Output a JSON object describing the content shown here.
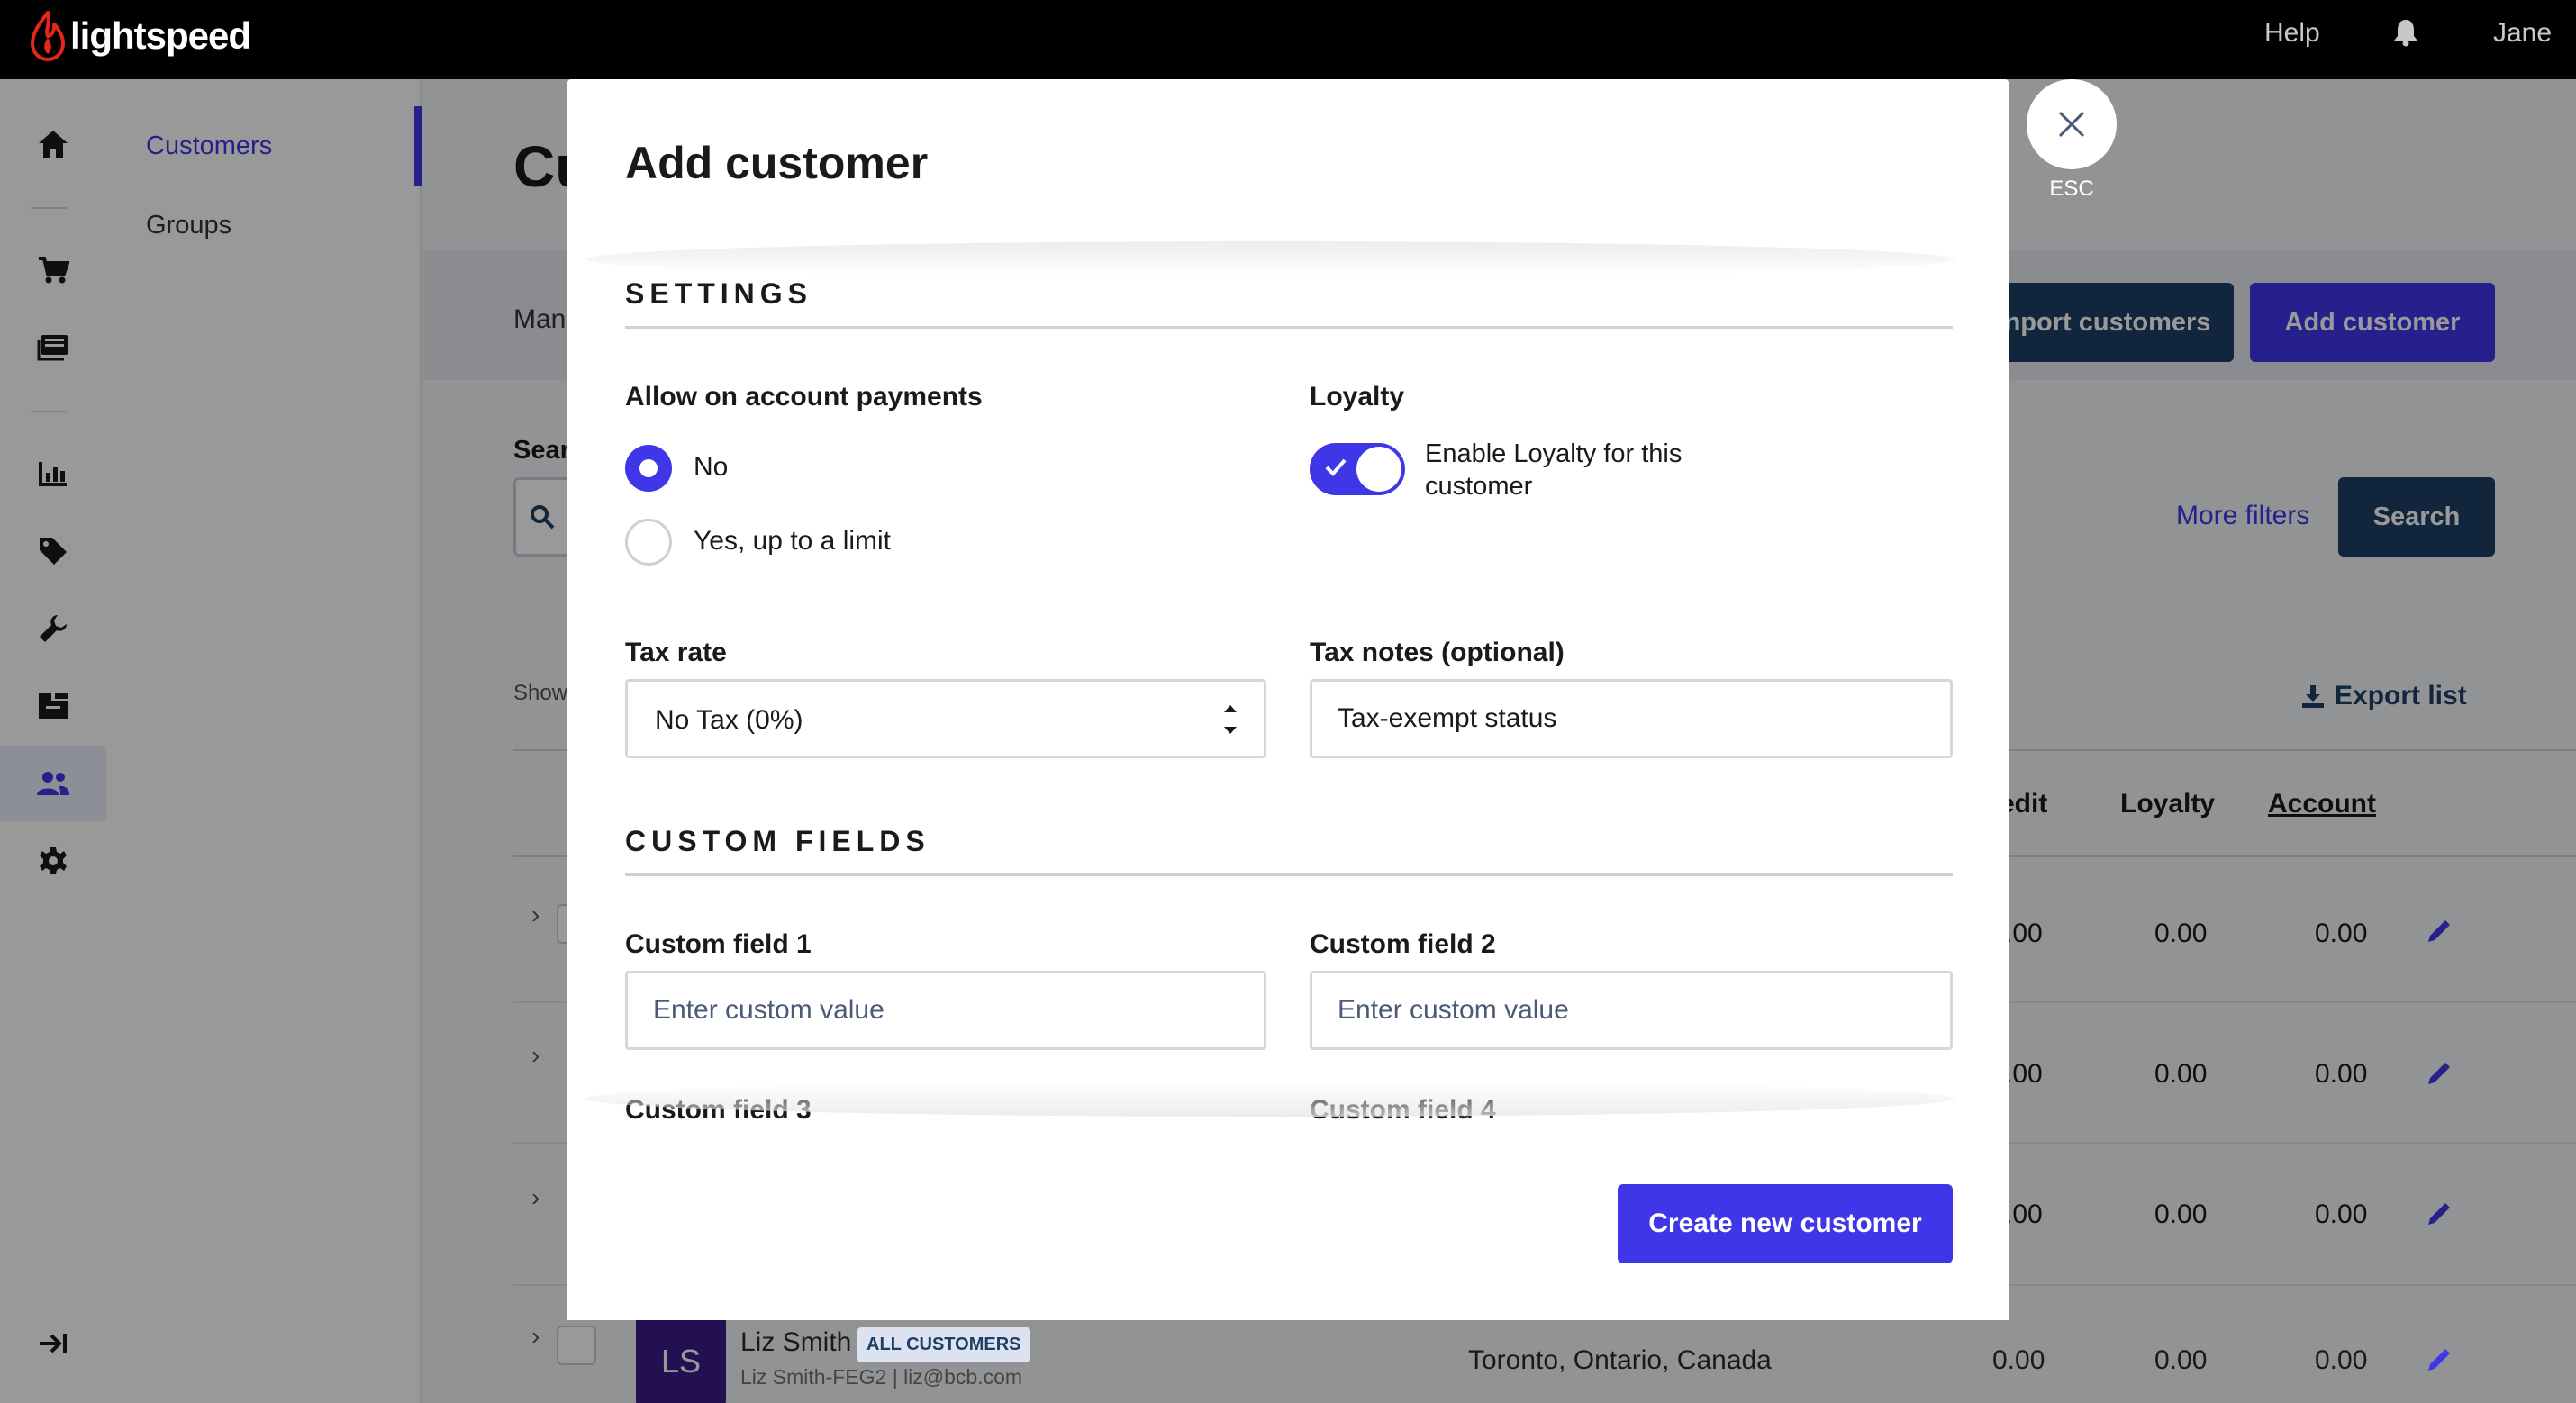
{
  "brand": {
    "name": "lightspeed",
    "accent": "#3f36e8"
  },
  "topbar": {
    "help": "Help",
    "user": "Jane"
  },
  "rail": {
    "icons": [
      "home-icon",
      "cart-icon",
      "register-icon",
      "reports-icon",
      "tag-icon",
      "wrench-icon",
      "inventory-icon",
      "customers-icon",
      "gear-icon"
    ],
    "collapse_icon": "collapse-icon"
  },
  "subnav": {
    "items": [
      {
        "label": "Customers",
        "active": true
      },
      {
        "label": "Groups",
        "active": false
      }
    ]
  },
  "background": {
    "title": "Cu",
    "band_text": "Man",
    "import_button": "nport customers",
    "add_button": "Add customer",
    "search_label": "Sear",
    "more_filters": "More filters",
    "search_button": "Search",
    "show_text": "Show",
    "export": "Export list",
    "columns": {
      "credit": "edit",
      "loyalty": "Loyalty",
      "account": "Account"
    },
    "rows": [
      {
        "credit": ".00",
        "loyalty": "0.00",
        "account": "0.00"
      },
      {
        "credit": ".00",
        "loyalty": "0.00",
        "account": "0.00"
      },
      {
        "credit": ".00",
        "loyalty": "0.00",
        "account": "0.00"
      }
    ],
    "last_row": {
      "initials": "LS",
      "name": "Liz Smith",
      "tag": "ALL CUSTOMERS",
      "sub": "Liz Smith-FEG2 | liz@bcb.com",
      "location": "Toronto, Ontario, Canada",
      "credit": "0.00",
      "loyalty": "0.00",
      "account": "0.00"
    }
  },
  "modal": {
    "title": "Add customer",
    "close_label": "ESC",
    "settings": {
      "title": "SETTINGS",
      "account_payments": {
        "label": "Allow on account payments",
        "options": [
          {
            "label": "No",
            "checked": true
          },
          {
            "label": "Yes, up to a limit",
            "checked": false
          }
        ]
      },
      "loyalty": {
        "label": "Loyalty",
        "toggle_label": "Enable Loyalty for this customer",
        "enabled": true
      },
      "tax_rate": {
        "label": "Tax rate",
        "value": "No Tax (0%)"
      },
      "tax_notes": {
        "label": "Tax notes (optional)",
        "value": "Tax-exempt status"
      }
    },
    "custom_fields": {
      "title": "CUSTOM FIELDS",
      "fields": [
        {
          "label": "Custom field 1",
          "placeholder": "Enter custom value"
        },
        {
          "label": "Custom field 2",
          "placeholder": "Enter custom value"
        },
        {
          "label": "Custom field 3",
          "placeholder": ""
        },
        {
          "label": "Custom field 4",
          "placeholder": ""
        }
      ]
    },
    "submit": "Create new customer"
  }
}
